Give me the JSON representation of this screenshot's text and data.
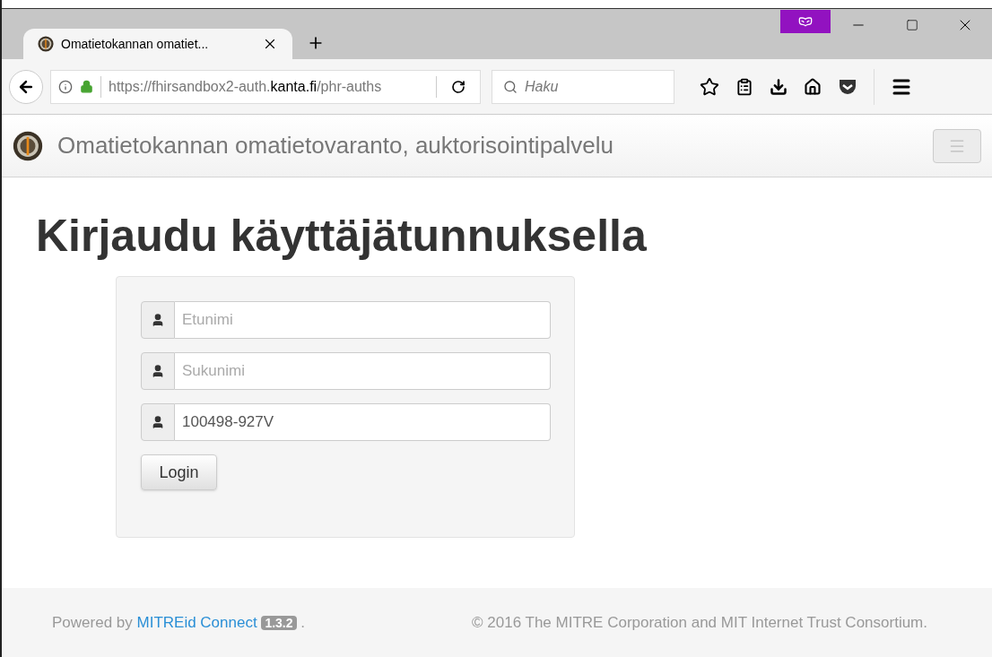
{
  "browser": {
    "tabs": [
      {
        "title": "Omatietokannan omatiet...",
        "selected": true
      }
    ],
    "url_parts": [
      {
        "text": "https://fhirsandbox2-auth.",
        "highlighted": false
      },
      {
        "text": "kanta.fi",
        "highlighted": true
      },
      {
        "text": "/phr-auths",
        "highlighted": false
      }
    ],
    "search": {
      "placeholder": "Haku"
    },
    "private": true
  },
  "navbar": {
    "brand": "Omatietokannan omatietovaranto, auktorisointipalvelu"
  },
  "heading": "Kirjaudu käyttäjätunnuksella",
  "fields": [
    {
      "placeholder": "Etunimi"
    },
    {
      "placeholder": "Sukunimi"
    },
    {
      "value": "100498-927V"
    }
  ],
  "login_button": "Login",
  "footer": {
    "powered_by": "Powered by ",
    "link": "MITREid Connect",
    "version": "1.3.2",
    "after": " .",
    "copyright": "© 2016 The MITRE Corporation and MIT Internet Trust Consortium."
  }
}
